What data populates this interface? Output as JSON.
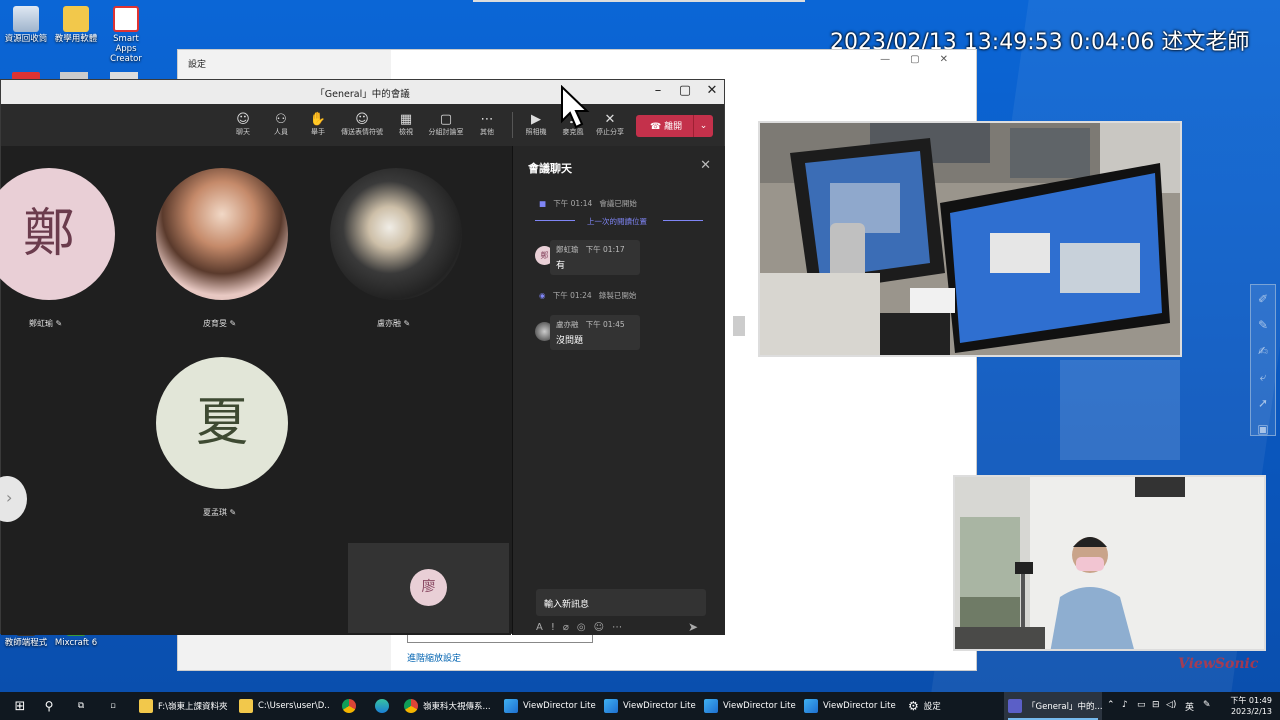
{
  "overlay": {
    "text": "2023/02/13 13:49:53 0:04:06 述文老師"
  },
  "desktop_icons": [
    {
      "label": "資源回收筒",
      "icon": "recycle-bin-icon"
    },
    {
      "label": "教學用軟體",
      "icon": "folder-icon"
    },
    {
      "label": "Smart Apps Creator",
      "icon": "app-icon"
    },
    {
      "label": "教師端程式",
      "icon": "app-icon"
    },
    {
      "label": "Mixcraft 6",
      "icon": "app-icon"
    }
  ],
  "settings_window": {
    "title": "設定",
    "link_advanced": "進階縮放設定"
  },
  "teams_window": {
    "title": "「General」中的會議",
    "toolbar": [
      {
        "label": "聊天",
        "icon": "chat-icon",
        "glyph": "☺"
      },
      {
        "label": "人員",
        "icon": "people-icon",
        "glyph": "⚇"
      },
      {
        "label": "舉手",
        "icon": "raise-hand-icon",
        "glyph": "✋"
      },
      {
        "label": "傳送表情符號",
        "icon": "emoji-icon",
        "glyph": "☺"
      },
      {
        "label": "檢視",
        "icon": "view-icon",
        "glyph": "▦"
      },
      {
        "label": "分組討論室",
        "icon": "breakout-icon",
        "glyph": "▢"
      },
      {
        "label": "其他",
        "icon": "more-icon",
        "glyph": "⋯"
      },
      {
        "label": "照相機",
        "icon": "camera-off-icon",
        "glyph": "▶"
      },
      {
        "label": "麥克風",
        "icon": "mic-icon",
        "glyph": "♪"
      },
      {
        "label": "停止分享",
        "icon": "stop-share-icon",
        "glyph": "✕"
      }
    ],
    "leave_label": "離開",
    "participants": [
      {
        "name": "鄭虹瑜",
        "initial": "鄭"
      },
      {
        "name": "皮育旻",
        "initial": ""
      },
      {
        "name": "盧亦融",
        "initial": ""
      },
      {
        "name": "夏孟琪",
        "initial": "夏"
      },
      {
        "name": "",
        "initial": "廖"
      }
    ],
    "chat": {
      "header": "會議聊天",
      "events": [
        {
          "time": "下午 01:14",
          "text": "會議已開始"
        },
        {
          "divider": "上一次的閱讀位置"
        },
        {
          "time": "下午 01:24",
          "text": "錄製已開始"
        }
      ],
      "messages": [
        {
          "sender": "鄭虹瑜",
          "time": "下午 01:17",
          "text": "有"
        },
        {
          "sender": "盧亦融",
          "time": "下午 01:45",
          "text": "沒問題"
        }
      ],
      "input_placeholder": "輸入新訊息"
    }
  },
  "taskbar": {
    "items": [
      {
        "label": "F:\\嶺東上課資料夾",
        "icon": "folder-icon"
      },
      {
        "label": "C:\\Users\\user\\D...",
        "icon": "folder-icon"
      },
      {
        "label": "",
        "icon": "chrome-icon"
      },
      {
        "label": "",
        "icon": "edge-icon"
      },
      {
        "label": "嶺東科大視傳系...",
        "icon": "chrome-icon"
      },
      {
        "label": "ViewDirector Lite",
        "icon": "viewdirector-icon"
      },
      {
        "label": "ViewDirector Lite",
        "icon": "viewdirector-icon"
      },
      {
        "label": "ViewDirector Lite",
        "icon": "viewdirector-icon"
      },
      {
        "label": "ViewDirector Lite",
        "icon": "viewdirector-icon"
      },
      {
        "label": "設定",
        "icon": "gear-icon"
      },
      {
        "label": "「General」中的...",
        "icon": "teams-icon"
      }
    ],
    "ime": "英",
    "clock_time": "下午 01:49",
    "clock_date": "2023/2/13"
  },
  "watermark": "ViewSonic",
  "colors": {
    "desktop": "#0a5fc8",
    "teams_dark": "#1f1f1f",
    "leave_red": "#c4314b",
    "accent_purple": "#7f85f5",
    "taskbar": "#101820"
  }
}
